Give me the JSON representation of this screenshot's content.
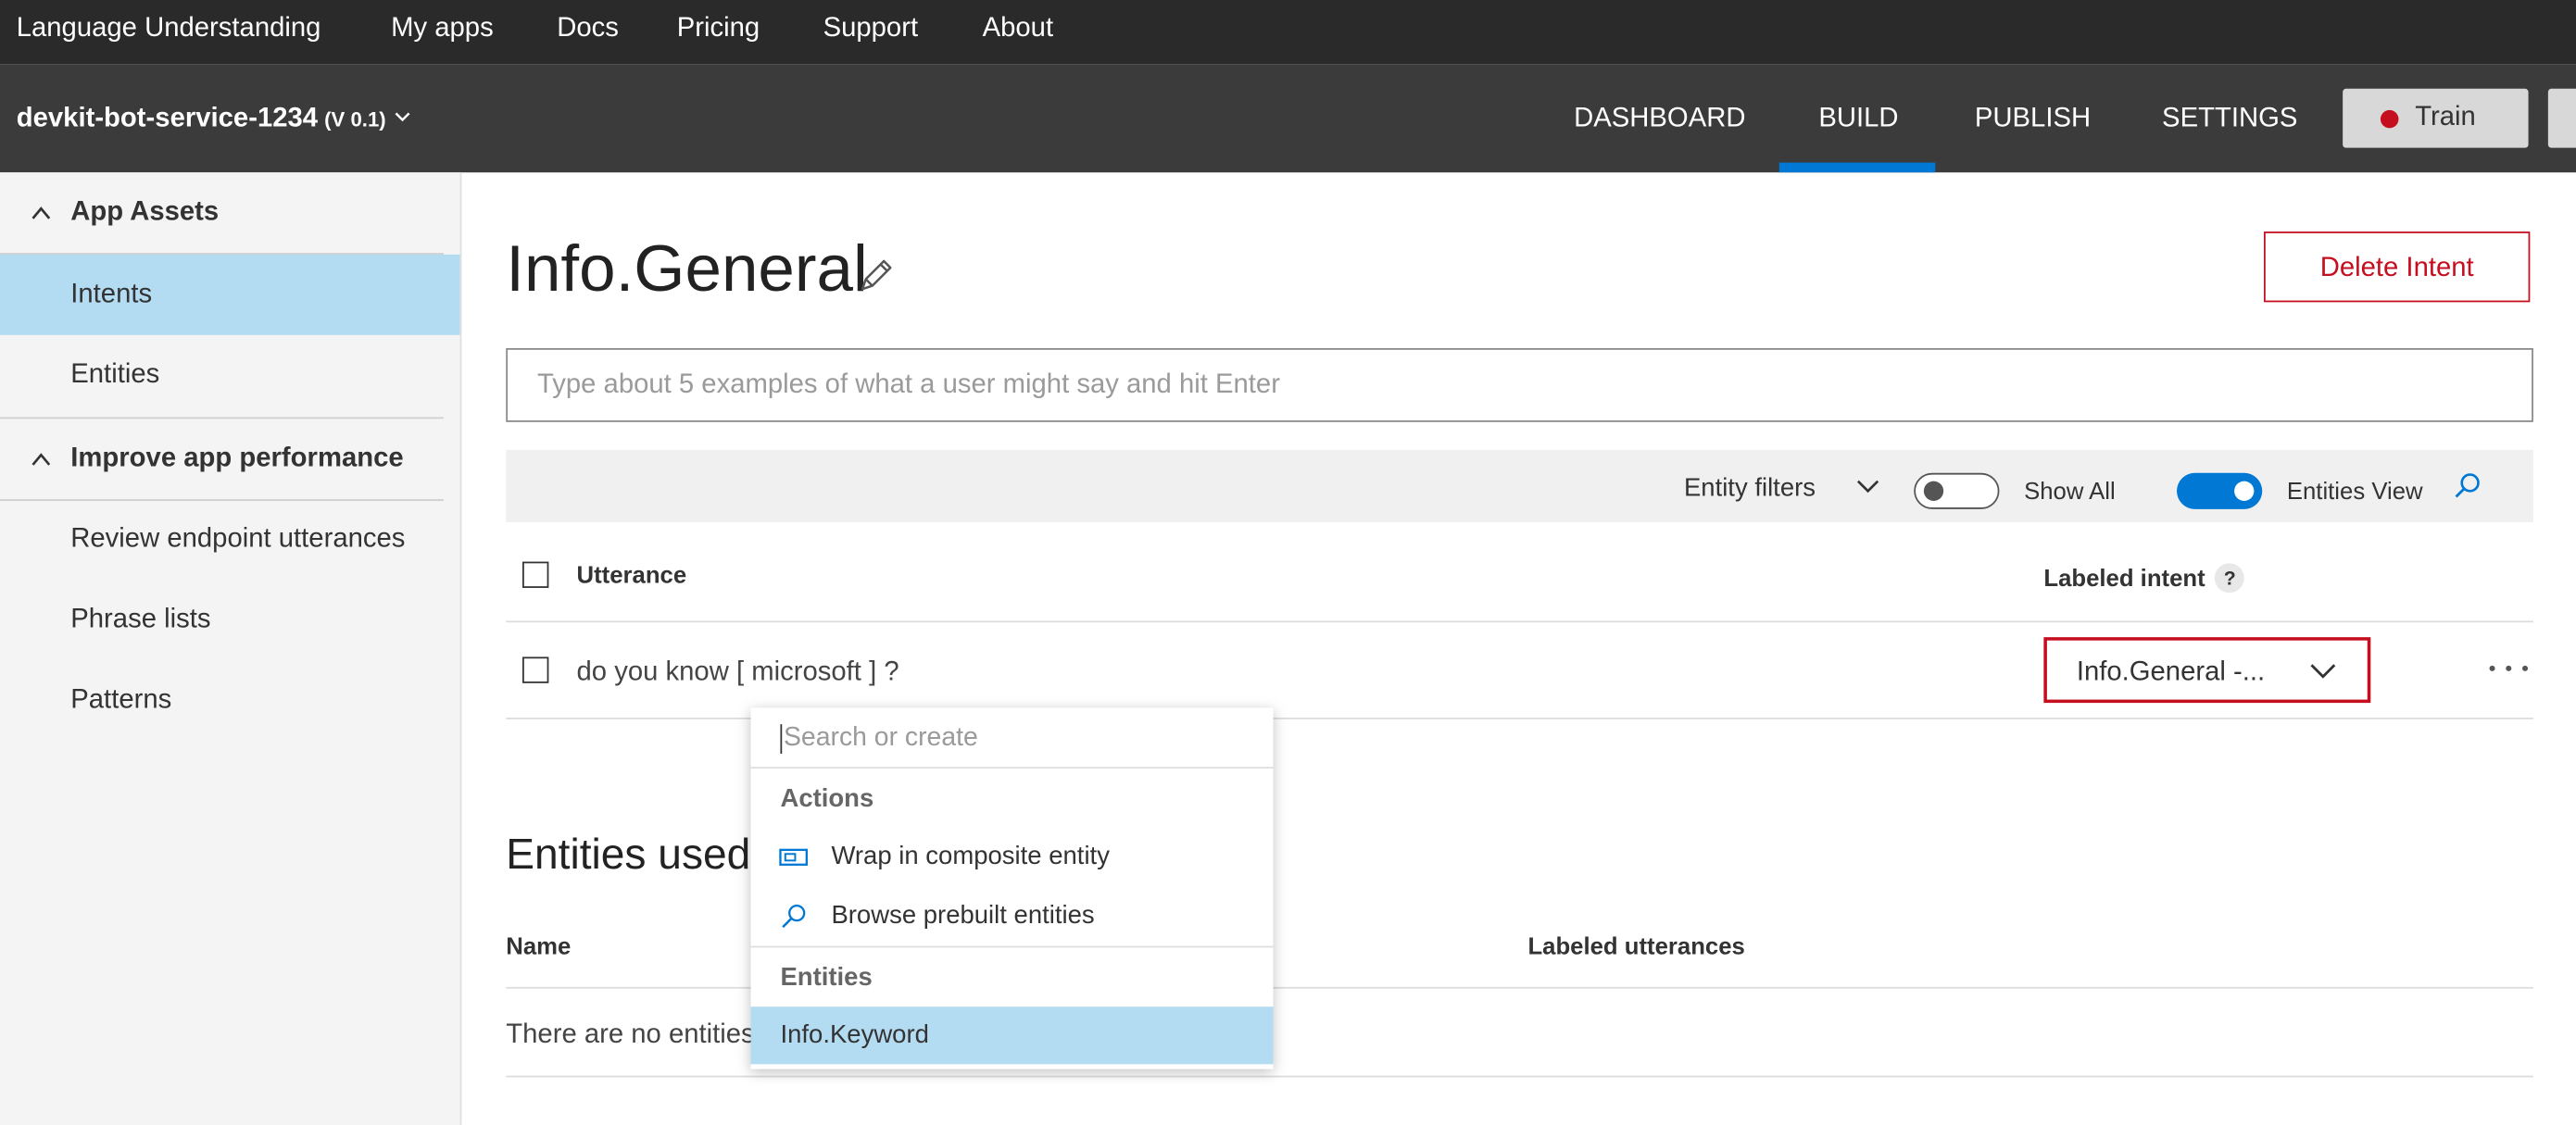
{
  "top_nav": {
    "items": [
      {
        "label": "Language Understanding"
      },
      {
        "label": "My apps"
      },
      {
        "label": "Docs"
      },
      {
        "label": "Pricing"
      },
      {
        "label": "Support"
      },
      {
        "label": "About"
      }
    ]
  },
  "app_bar": {
    "app_name": "devkit-bot-service-1234",
    "version": "(V 0.1)",
    "tabs": [
      {
        "label": "DASHBOARD"
      },
      {
        "label": "BUILD",
        "active": true
      },
      {
        "label": "PUBLISH"
      },
      {
        "label": "SETTINGS"
      }
    ],
    "train_label": "Train",
    "train_status_color": "#c50f1f",
    "accent_color": "#0078d4"
  },
  "sidebar": {
    "group1": "App Assets",
    "group1_items": [
      {
        "label": "Intents",
        "active": true
      },
      {
        "label": "Entities"
      }
    ],
    "group2": "Improve app performance",
    "group2_items": [
      {
        "label": "Review endpoint utterances"
      },
      {
        "label": "Phrase lists"
      },
      {
        "label": "Patterns"
      }
    ],
    "active_color": "#b3dcf2"
  },
  "main": {
    "title": "Info.General",
    "delete_label": "Delete Intent",
    "utterance_placeholder": "Type about 5 examples of what a user might say and hit Enter",
    "filters": {
      "entity_filters": "Entity filters",
      "show_all": "Show All",
      "show_all_on": false,
      "entities_view": "Entities View",
      "entities_view_on": true
    },
    "table": {
      "col_utterance": "Utterance",
      "col_intent": "Labeled intent",
      "help": "?",
      "rows": [
        {
          "utterance": "do you know [ microsoft ] ?",
          "intent": "Info.General -..."
        }
      ]
    },
    "entities_section": {
      "title": "Entities used in this intent",
      "col_name": "Name",
      "col_labeled": "Labeled utterances",
      "empty": "There are no entities"
    }
  },
  "popup": {
    "search_placeholder": "Search or create",
    "actions_header": "Actions",
    "actions": [
      {
        "label": "Wrap in composite entity",
        "icon": "composite-icon"
      },
      {
        "label": "Browse prebuilt entities",
        "icon": "search-icon"
      }
    ],
    "entities_header": "Entities",
    "entities": [
      {
        "label": "Info.Keyword",
        "highlighted": true
      }
    ]
  }
}
